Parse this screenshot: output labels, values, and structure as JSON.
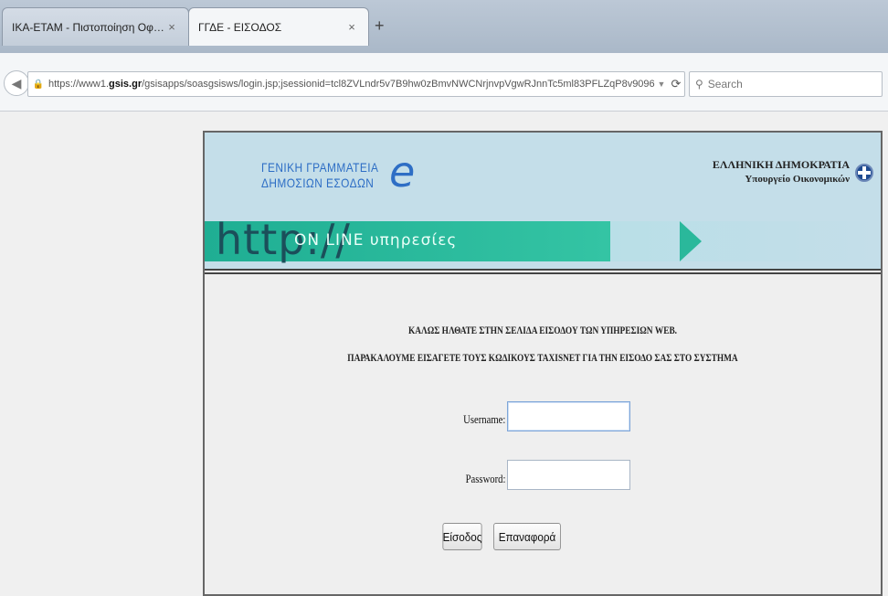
{
  "browser": {
    "tabs": [
      {
        "label": "ΙΚΑ-ΕΤΑΜ - Πιστοποίηση Οφε...",
        "active": false
      },
      {
        "label": "ΓΓΔΕ - ΕΙΣΟΔΟΣ",
        "active": true
      }
    ],
    "tab_close_glyph": "×",
    "new_tab_glyph": "+",
    "url_prefix": "https://www1.",
    "url_domain": "gsis.gr",
    "url_path": "/gsisapps/soasgsisws/login.jsp;jsessionid=tcl8ZVLndr5v7B9hw0zBmvNWCNrjnvpVgwRJnnTc5ml83PFLZqP8v9096(",
    "search_placeholder": "Search"
  },
  "header": {
    "logo_line1": "ΓΕΝΙΚΗ ΓΡΑΜΜΑΤΕΙΑ",
    "logo_line2": "ΔΗΜΟΣΙΩΝ ΕΣΟΔΩΝ",
    "logo_e": "e",
    "republic_line1": "ΕΛΛΗΝΙΚΗ ΔΗΜΟΚΡΑΤΙΑ",
    "republic_line2": "Υπουργείο Οικονομικών",
    "banner_http": "http://",
    "banner_services": "ΟΝ LINE υπηρεσίες"
  },
  "login": {
    "welcome_line1": "ΚΑΛΩΣ ΗΛΘΑΤΕ ΣΤΗΝ ΣΕΛΙΔΑ ΕΙΣΟΔΟΥ ΤΩΝ ΥΠΗΡΕΣΙΩΝ WEB.",
    "welcome_line2": "ΠΑΡΑΚΑΛΟΥΜΕ ΕΙΣΑΓΕΤΕ ΤΟΥΣ ΚΩΔΙΚΟΥΣ TAXISNET ΓΙΑ ΤΗΝ ΕΙΣΟΔΟ ΣΑΣ ΣΤΟ ΣΥΣΤΗΜΑ",
    "username_label": "Username:",
    "password_label": "Password:",
    "username_value": "",
    "password_value": "",
    "login_button": "Είσοδος",
    "reset_button": "Επαναφορά"
  }
}
